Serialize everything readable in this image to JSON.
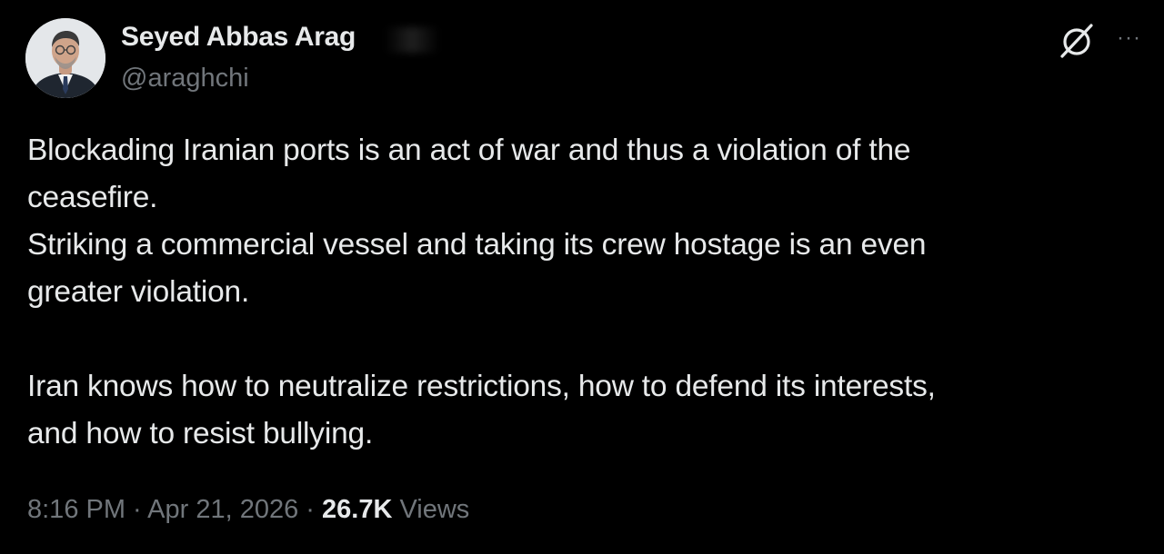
{
  "author": {
    "display_name": "Seyed Abbas Arag",
    "handle": "@araghchi",
    "avatar_icon": "person-portrait-icon"
  },
  "header_actions": {
    "grok_icon": "grok-slashed-circle-icon",
    "more_icon": "more-horizontal-icon",
    "more_glyph": "···"
  },
  "tweet": {
    "lines": [
      "Blockading Iranian ports is an act of war and thus a violation of the",
      "ceasefire.",
      "Striking a commercial vessel and taking its crew hostage is an even",
      "greater violation.",
      "Iran knows how to neutralize restrictions, how to defend its interests,",
      "and how to resist bullying."
    ]
  },
  "meta": {
    "time": "8:16 PM",
    "separator": " · ",
    "date": "Apr 21, 2026",
    "views_count": "26.7K",
    "views_label": " Views"
  },
  "colors": {
    "background": "#000000",
    "primary_text": "#e7e9ea",
    "secondary_text": "#71767b"
  }
}
